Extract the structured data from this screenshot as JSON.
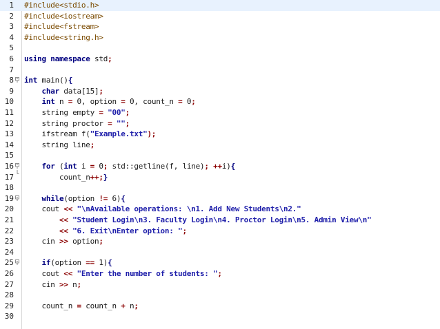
{
  "editor": {
    "current_line": 1,
    "colors": {
      "preprocessor": "#7a4a00",
      "keyword": "#000080",
      "string": "#1f1faa",
      "operator": "#8b0000",
      "text": "#1a1a1a",
      "current_line_bg": "#e8f2fe",
      "gutter_border": "#d6d6d6"
    },
    "lines": [
      {
        "n": "1",
        "fold": "",
        "tokens": [
          {
            "t": "#include<stdio.h>",
            "c": "pre"
          }
        ]
      },
      {
        "n": "2",
        "fold": "",
        "tokens": [
          {
            "t": "#include<iostream>",
            "c": "pre"
          }
        ]
      },
      {
        "n": "3",
        "fold": "",
        "tokens": [
          {
            "t": "#include<fstream>",
            "c": "pre"
          }
        ]
      },
      {
        "n": "4",
        "fold": "",
        "tokens": [
          {
            "t": "#include<string.h>",
            "c": "pre"
          }
        ]
      },
      {
        "n": "5",
        "fold": "",
        "tokens": []
      },
      {
        "n": "6",
        "fold": "",
        "tokens": [
          {
            "t": "using namespace",
            "c": "kw"
          },
          {
            "t": " std",
            "c": "txt"
          },
          {
            "t": ";",
            "c": "op"
          }
        ]
      },
      {
        "n": "7",
        "fold": "",
        "tokens": []
      },
      {
        "n": "8",
        "fold": "open",
        "tokens": [
          {
            "t": "int",
            "c": "kw"
          },
          {
            "t": " main()",
            "c": "txt"
          },
          {
            "t": "{",
            "c": "brace"
          }
        ]
      },
      {
        "n": "9",
        "fold": "",
        "tokens": [
          {
            "t": "    ",
            "c": "txt"
          },
          {
            "t": "char",
            "c": "kw"
          },
          {
            "t": " data[15]",
            "c": "txt"
          },
          {
            "t": ";",
            "c": "op"
          }
        ]
      },
      {
        "n": "10",
        "fold": "",
        "tokens": [
          {
            "t": "    ",
            "c": "txt"
          },
          {
            "t": "int",
            "c": "kw"
          },
          {
            "t": " n ",
            "c": "txt"
          },
          {
            "t": "=",
            "c": "op"
          },
          {
            "t": " 0, option ",
            "c": "txt"
          },
          {
            "t": "=",
            "c": "op"
          },
          {
            "t": " 0, count_n ",
            "c": "txt"
          },
          {
            "t": "=",
            "c": "op"
          },
          {
            "t": " 0",
            "c": "txt"
          },
          {
            "t": ";",
            "c": "op"
          }
        ]
      },
      {
        "n": "11",
        "fold": "",
        "tokens": [
          {
            "t": "    string empty ",
            "c": "txt"
          },
          {
            "t": "=",
            "c": "op"
          },
          {
            "t": " ",
            "c": "txt"
          },
          {
            "t": "\"00\"",
            "c": "str"
          },
          {
            "t": ";",
            "c": "op"
          }
        ]
      },
      {
        "n": "12",
        "fold": "",
        "tokens": [
          {
            "t": "    string proctor ",
            "c": "txt"
          },
          {
            "t": "=",
            "c": "op"
          },
          {
            "t": " ",
            "c": "txt"
          },
          {
            "t": "\"\"",
            "c": "str"
          },
          {
            "t": ";",
            "c": "op"
          }
        ]
      },
      {
        "n": "13",
        "fold": "",
        "tokens": [
          {
            "t": "    ifstream f(",
            "c": "txt"
          },
          {
            "t": "\"Example.txt\"",
            "c": "str"
          },
          {
            "t": ");",
            "c": "op"
          }
        ]
      },
      {
        "n": "14",
        "fold": "",
        "tokens": [
          {
            "t": "    string line",
            "c": "txt"
          },
          {
            "t": ";",
            "c": "op"
          }
        ]
      },
      {
        "n": "15",
        "fold": "",
        "tokens": []
      },
      {
        "n": "16",
        "fold": "open",
        "tokens": [
          {
            "t": "    ",
            "c": "txt"
          },
          {
            "t": "for",
            "c": "kw"
          },
          {
            "t": " (",
            "c": "txt"
          },
          {
            "t": "int",
            "c": "kw"
          },
          {
            "t": " i ",
            "c": "txt"
          },
          {
            "t": "=",
            "c": "op"
          },
          {
            "t": " 0",
            "c": "txt"
          },
          {
            "t": ";",
            "c": "op"
          },
          {
            "t": " std::getline(f, line)",
            "c": "txt"
          },
          {
            "t": ";",
            "c": "op"
          },
          {
            "t": " ",
            "c": "txt"
          },
          {
            "t": "++",
            "c": "op"
          },
          {
            "t": "i)",
            "c": "txt"
          },
          {
            "t": "{",
            "c": "brace"
          }
        ]
      },
      {
        "n": "17",
        "fold": "end",
        "tokens": [
          {
            "t": "        count_n",
            "c": "txt"
          },
          {
            "t": "++;",
            "c": "op"
          },
          {
            "t": "}",
            "c": "brace"
          }
        ]
      },
      {
        "n": "18",
        "fold": "",
        "tokens": []
      },
      {
        "n": "19",
        "fold": "open",
        "tokens": [
          {
            "t": "    ",
            "c": "txt"
          },
          {
            "t": "while",
            "c": "kw"
          },
          {
            "t": "(option ",
            "c": "txt"
          },
          {
            "t": "!=",
            "c": "op"
          },
          {
            "t": " 6)",
            "c": "txt"
          },
          {
            "t": "{",
            "c": "brace"
          }
        ]
      },
      {
        "n": "20",
        "fold": "",
        "tokens": [
          {
            "t": "    cout ",
            "c": "txt"
          },
          {
            "t": "<<",
            "c": "op"
          },
          {
            "t": " ",
            "c": "txt"
          },
          {
            "t": "\"\\nAvailable operations: \\n1. Add New Students\\n2.\"",
            "c": "str"
          }
        ]
      },
      {
        "n": "21",
        "fold": "",
        "tokens": [
          {
            "t": "        ",
            "c": "txt"
          },
          {
            "t": "<<",
            "c": "op"
          },
          {
            "t": " ",
            "c": "txt"
          },
          {
            "t": "\"Student Login\\n3. Faculty Login\\n4. Proctor Login\\n5. Admin View\\n\"",
            "c": "str"
          }
        ]
      },
      {
        "n": "22",
        "fold": "",
        "tokens": [
          {
            "t": "        ",
            "c": "txt"
          },
          {
            "t": "<<",
            "c": "op"
          },
          {
            "t": " ",
            "c": "txt"
          },
          {
            "t": "\"6. Exit\\nEnter option: \"",
            "c": "str"
          },
          {
            "t": ";",
            "c": "op"
          }
        ]
      },
      {
        "n": "23",
        "fold": "",
        "tokens": [
          {
            "t": "    cin ",
            "c": "txt"
          },
          {
            "t": ">>",
            "c": "op"
          },
          {
            "t": " option",
            "c": "txt"
          },
          {
            "t": ";",
            "c": "op"
          }
        ]
      },
      {
        "n": "24",
        "fold": "",
        "tokens": []
      },
      {
        "n": "25",
        "fold": "open",
        "tokens": [
          {
            "t": "    ",
            "c": "txt"
          },
          {
            "t": "if",
            "c": "kw"
          },
          {
            "t": "(option ",
            "c": "txt"
          },
          {
            "t": "==",
            "c": "op"
          },
          {
            "t": " 1)",
            "c": "txt"
          },
          {
            "t": "{",
            "c": "brace"
          }
        ]
      },
      {
        "n": "26",
        "fold": "",
        "tokens": [
          {
            "t": "    cout ",
            "c": "txt"
          },
          {
            "t": "<<",
            "c": "op"
          },
          {
            "t": " ",
            "c": "txt"
          },
          {
            "t": "\"Enter the number of students: \"",
            "c": "str"
          },
          {
            "t": ";",
            "c": "op"
          }
        ]
      },
      {
        "n": "27",
        "fold": "",
        "tokens": [
          {
            "t": "    cin ",
            "c": "txt"
          },
          {
            "t": ">>",
            "c": "op"
          },
          {
            "t": " n",
            "c": "txt"
          },
          {
            "t": ";",
            "c": "op"
          }
        ]
      },
      {
        "n": "28",
        "fold": "",
        "tokens": []
      },
      {
        "n": "29",
        "fold": "",
        "tokens": [
          {
            "t": "    count_n ",
            "c": "txt"
          },
          {
            "t": "=",
            "c": "op"
          },
          {
            "t": " count_n ",
            "c": "txt"
          },
          {
            "t": "+",
            "c": "op"
          },
          {
            "t": " n",
            "c": "txt"
          },
          {
            "t": ";",
            "c": "op"
          }
        ]
      },
      {
        "n": "30",
        "fold": "",
        "tokens": []
      }
    ]
  }
}
